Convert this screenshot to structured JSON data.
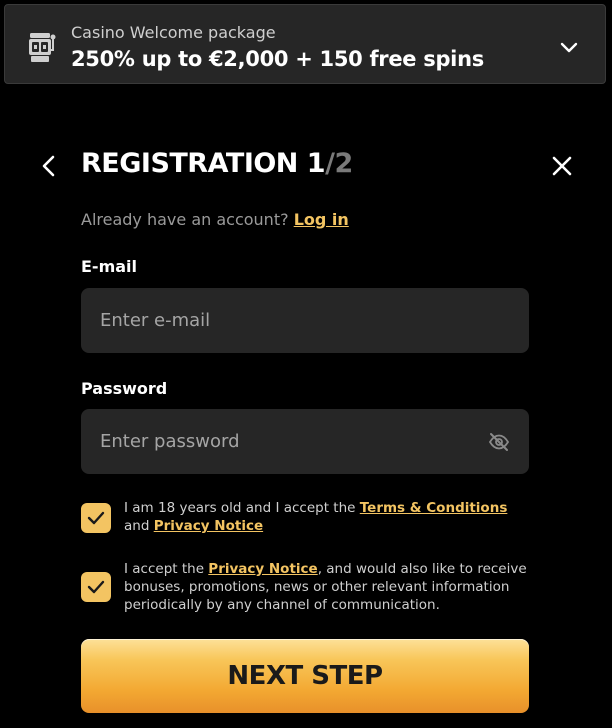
{
  "promo": {
    "subtitle": "Casino Welcome package",
    "headline": "250% up to €2,000 + 150 free spins",
    "icon": "slot-machine-icon",
    "toggle_icon": "chevron-down-icon"
  },
  "header": {
    "title_main": "REGISTRATION 1",
    "title_total": "/2",
    "back_icon": "chevron-left-icon",
    "close_icon": "close-icon"
  },
  "account": {
    "prompt": "Already have an account?",
    "login_label": "Log in"
  },
  "form": {
    "email": {
      "label": "E-mail",
      "placeholder": "Enter e-mail",
      "value": ""
    },
    "password": {
      "label": "Password",
      "placeholder": "Enter password",
      "value": "",
      "toggle_icon": "eye-off-icon"
    }
  },
  "consents": [
    {
      "checked": true,
      "text_before": "I am 18 years old and I accept the ",
      "link1": "Terms & Conditions",
      "text_middle": " and ",
      "link2": "Privacy Notice",
      "text_after": ""
    },
    {
      "checked": true,
      "text_before": "I accept the ",
      "link1": "Privacy Notice",
      "text_after": ", and would also like to receive bonuses, promotions, news or other relevant information periodically by any channel of communication."
    }
  ],
  "next_button": {
    "label": "NEXT STEP"
  },
  "colors": {
    "accent": "#f3c462",
    "field_bg": "#262626",
    "background": "#000000",
    "muted_text": "#9a9a9a"
  }
}
